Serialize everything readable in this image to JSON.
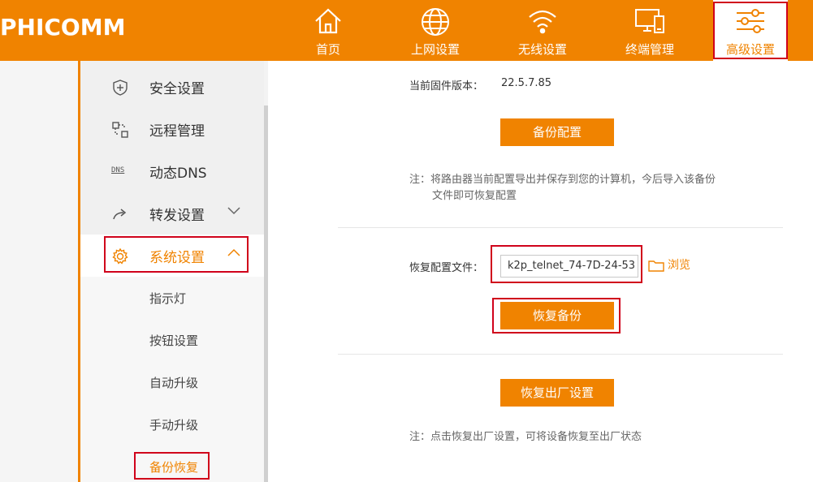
{
  "brand": "PHICOMM",
  "nav": [
    {
      "label": "首页",
      "icon": "home-icon"
    },
    {
      "label": "上网设置",
      "icon": "globe-icon"
    },
    {
      "label": "无线设置",
      "icon": "wifi-icon"
    },
    {
      "label": "终端管理",
      "icon": "devices-icon"
    },
    {
      "label": "高级设置",
      "icon": "sliders-icon"
    }
  ],
  "sidebar": {
    "items": [
      {
        "label": "安全设置",
        "icon": "shield-plus-icon"
      },
      {
        "label": "远程管理",
        "icon": "remote-icon"
      },
      {
        "label": "动态DNS",
        "icon": "dns-icon",
        "icon_text": "DNS"
      },
      {
        "label": "转发设置",
        "icon": "forward-icon",
        "chevron": "∨"
      },
      {
        "label": "系统设置",
        "icon": "gear-icon",
        "chevron": "∧"
      }
    ],
    "sub_items": [
      {
        "label": "指示灯"
      },
      {
        "label": "按钮设置"
      },
      {
        "label": "自动升级"
      },
      {
        "label": "手动升级"
      },
      {
        "label": "备份恢复"
      }
    ]
  },
  "main": {
    "firmware_label": "当前固件版本：",
    "firmware_value": "22.5.7.85",
    "backup_button": "备份配置",
    "backup_note_line1": "注：将路由器当前配置导出并保存到您的计算机，今后导入该备份",
    "backup_note_line2": "文件即可恢复配置",
    "restore_file_label": "恢复配置文件：",
    "restore_file_value": "k2p_telnet_74-7D-24-53",
    "browse_label": "浏览",
    "restore_button": "恢复备份",
    "factory_button": "恢复出厂设置",
    "factory_note": "注：点击恢复出厂设置，可将设备恢复至出厂状态"
  },
  "colors": {
    "brand_orange": "#f08300",
    "highlight_red": "#d0021b"
  }
}
